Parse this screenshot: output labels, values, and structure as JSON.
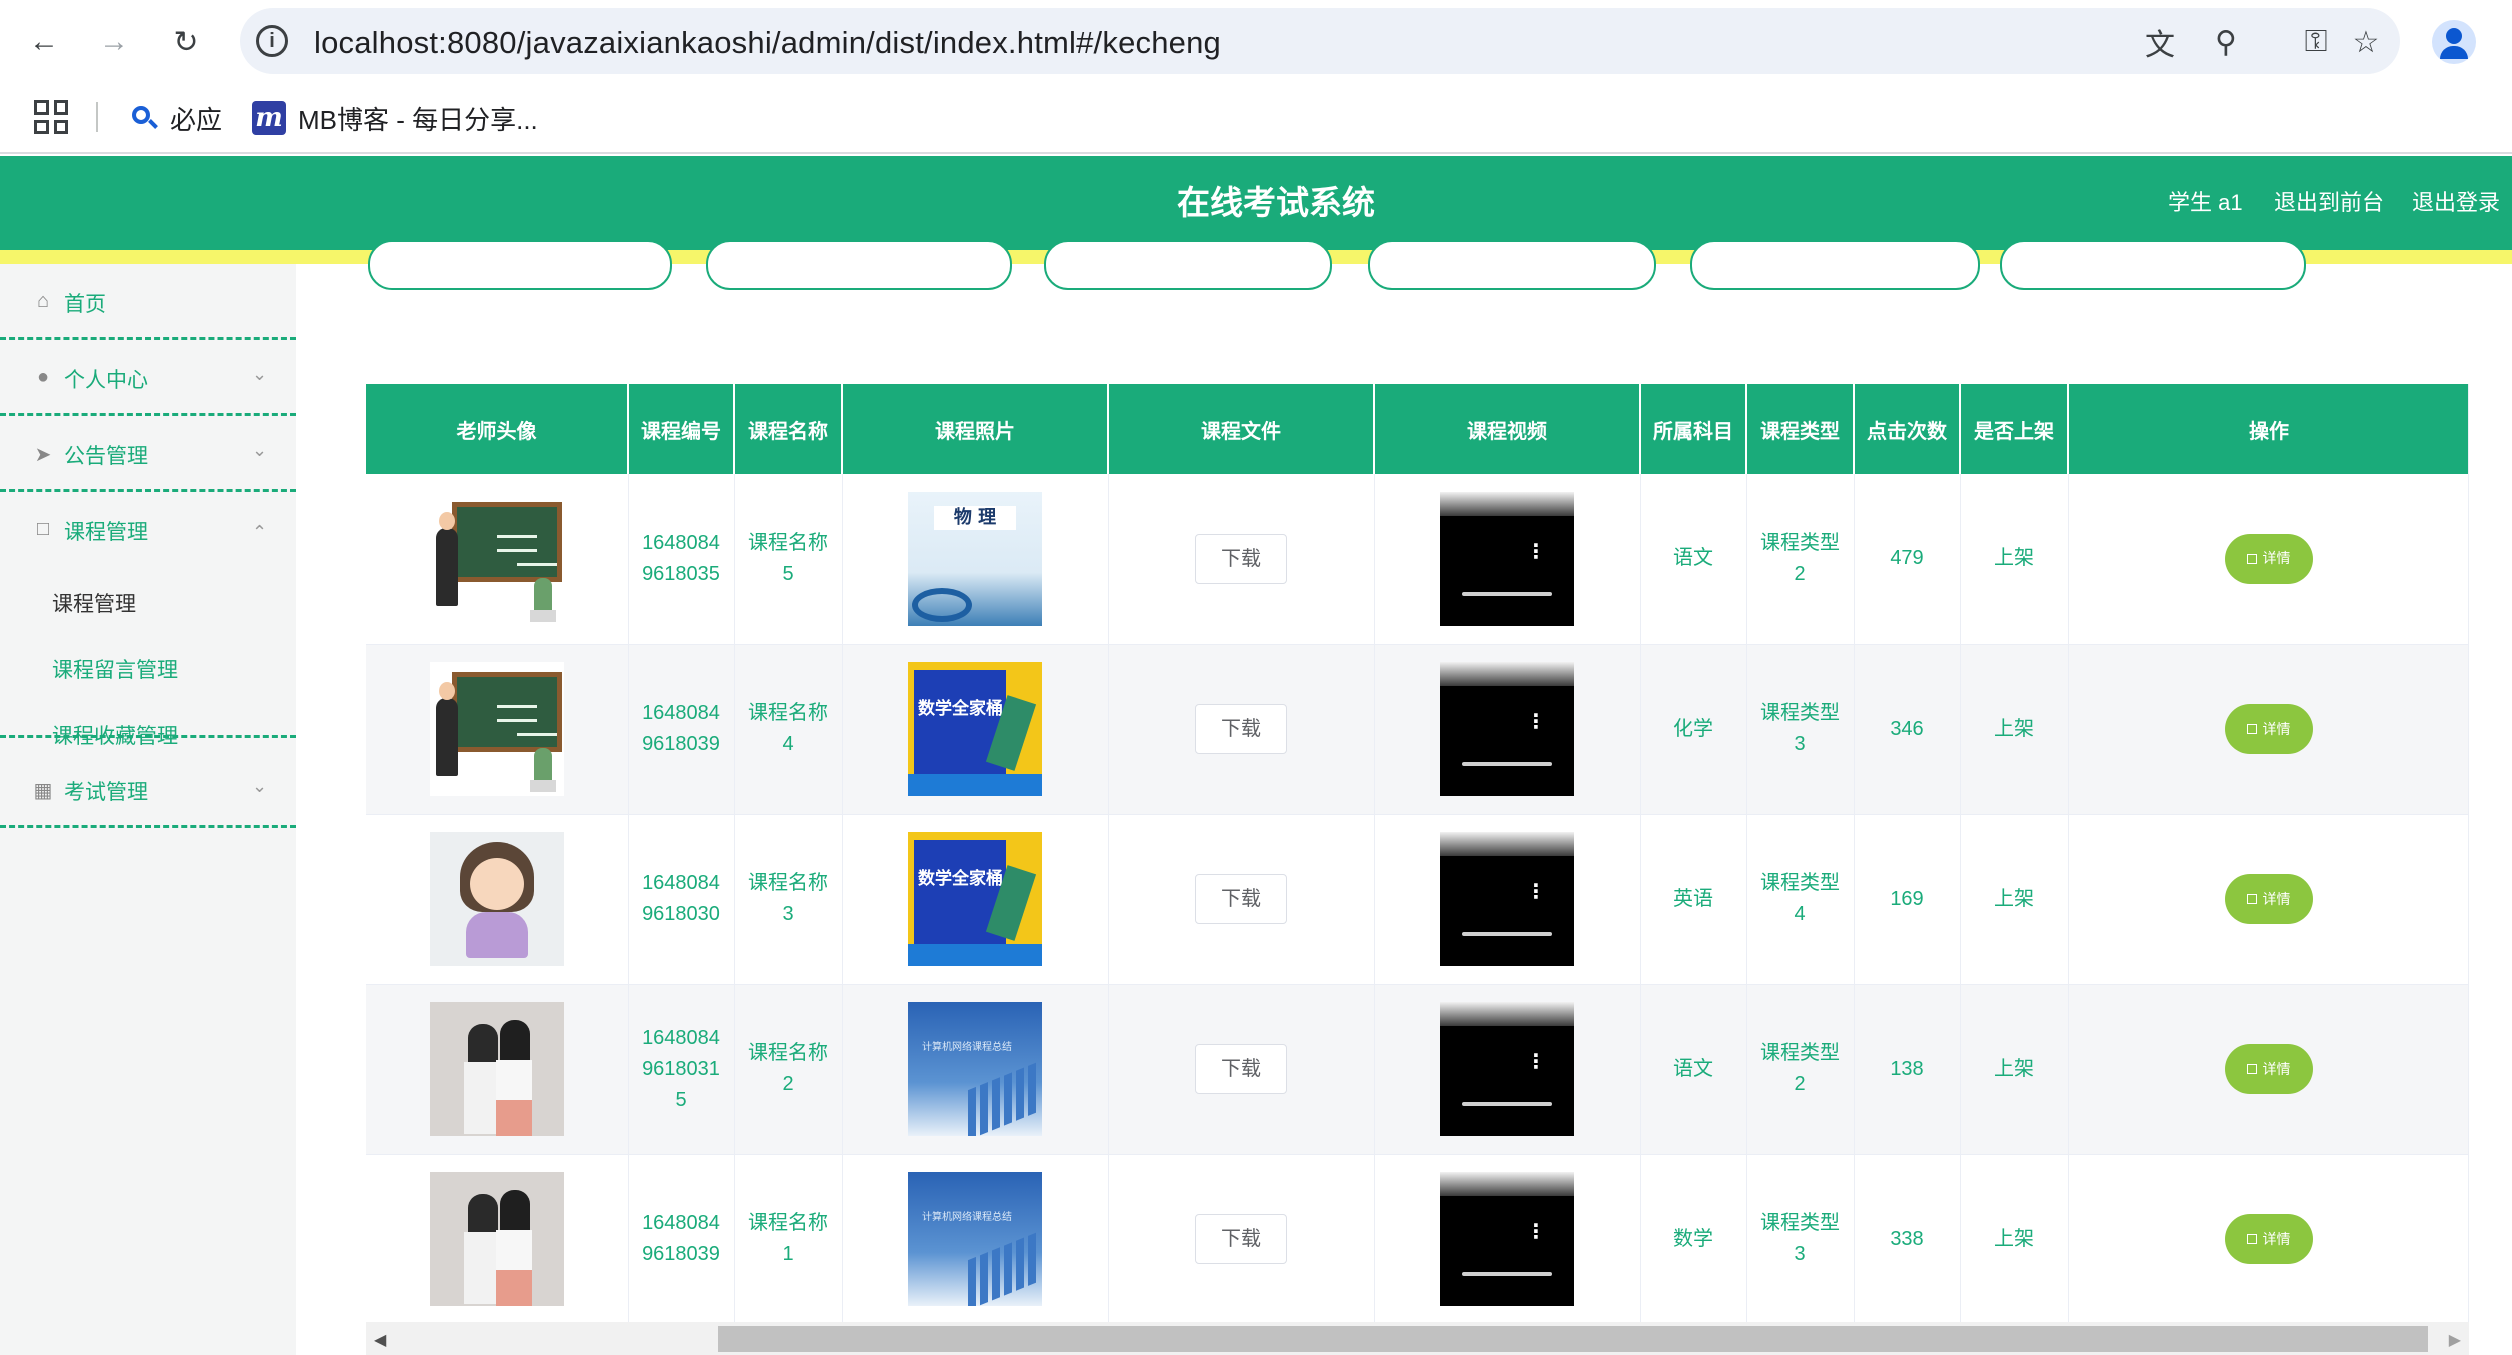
{
  "browser": {
    "url": "localhost:8080/javazaixiankaoshi/admin/dist/index.html#/kecheng",
    "bookmarks": [
      {
        "label": "必应",
        "icon": "bing-search-icon"
      },
      {
        "label": "MB博客 - 每日分享...",
        "icon": "mb-blog-icon"
      }
    ]
  },
  "header": {
    "title": "在线考试系统",
    "user_label": "学生 a1",
    "back_to_front": "退出到前台",
    "logout": "退出登录"
  },
  "sidebar": {
    "home": "首页",
    "personal_center": "个人中心",
    "announcement": "公告管理",
    "course_mgmt": "课程管理",
    "sub_items": [
      "课程管理",
      "课程留言管理",
      "课程收藏管理"
    ],
    "exam_mgmt": "考试管理"
  },
  "table": {
    "headers": [
      "老师头像",
      "课程编号",
      "课程名称",
      "课程照片",
      "课程文件",
      "课程视频",
      "所属科目",
      "课程类型",
      "点击次数",
      "是否上架",
      "操作"
    ],
    "download_label": "下载",
    "detail_label": "详情",
    "rows": [
      {
        "avatar": "teacher-chalkboard",
        "code": "1648084\n9618035",
        "name": "课程名称\n5",
        "cover": "physics-book",
        "subject": "语文",
        "type": "课程类型\n2",
        "clicks": "479",
        "status": "上架"
      },
      {
        "avatar": "teacher-chalkboard",
        "code": "1648084\n9618039",
        "name": "课程名称\n4",
        "cover": "math-book",
        "subject": "化学",
        "type": "课程类型\n3",
        "clicks": "346",
        "status": "上架"
      },
      {
        "avatar": "teacher-cartoon",
        "code": "1648084\n9618030",
        "name": "课程名称\n3",
        "cover": "math-book",
        "subject": "英语",
        "type": "课程类型\n4",
        "clicks": "169",
        "status": "上架"
      },
      {
        "avatar": "teacher-photo",
        "code": "1648084\n9618031\n5",
        "name": "课程名称\n2",
        "cover": "network-course",
        "subject": "语文",
        "type": "课程类型\n2",
        "clicks": "138",
        "status": "上架"
      },
      {
        "avatar": "teacher-photo",
        "code": "1648084\n9618039",
        "name": "课程名称\n1",
        "cover": "network-course",
        "subject": "数学",
        "type": "课程类型\n3",
        "clicks": "338",
        "status": "上架"
      }
    ]
  },
  "covers": {
    "physics_title": "物 理",
    "math_title": "数学全家桶",
    "network_caption": "计算机网络课程总结"
  },
  "colors": {
    "primary": "#1aab7a",
    "highlight_strip": "#f6f66a",
    "detail_button": "#8cc63f"
  }
}
